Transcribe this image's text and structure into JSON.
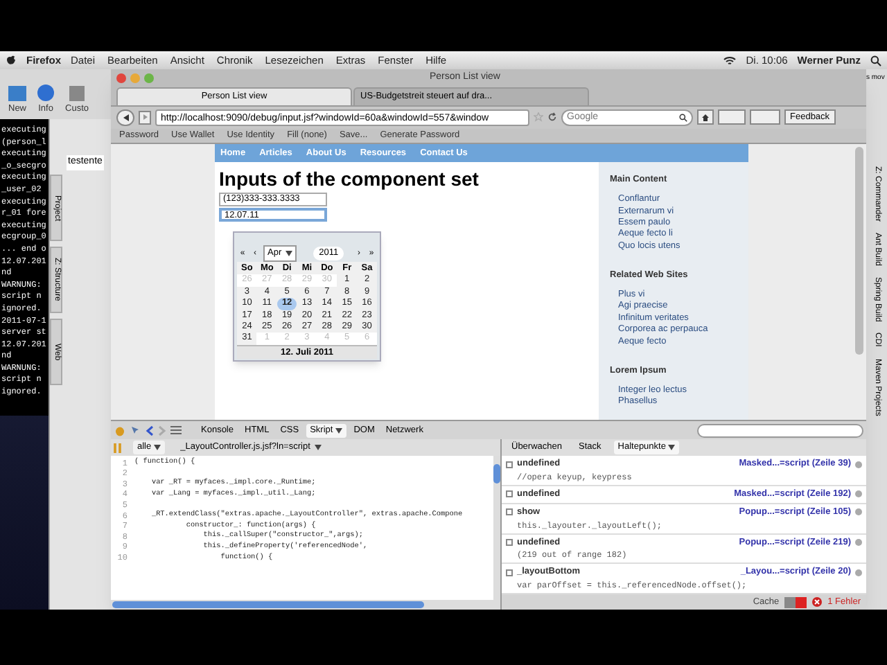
{
  "menu_bar": {
    "app": "Firefox",
    "items": [
      "Datei",
      "Bearbeiten",
      "Ansicht",
      "Chronik",
      "Lesezeichen",
      "Extras",
      "Fenster",
      "Hilfe"
    ],
    "clock": "Di. 10:06",
    "user": "Werner Punz"
  },
  "toolbar_window": {
    "buttons": [
      "New",
      "Info",
      "Custo"
    ]
  },
  "terminal": {
    "lines": [
      "executing",
      "(person_l",
      "executing",
      "_o_secgro",
      "executing",
      "_user_02",
      "executing",
      "r_01 fore",
      "executing",
      "ecgroup_0",
      "... end o",
      "12.07.201",
      "nd",
      "WARNUNG: ",
      "script n",
      "ignored.",
      "2011-07-1",
      "server st",
      "12.07.201",
      "nd",
      "WARNUNG: ",
      "script n",
      "ignored."
    ]
  },
  "ide": {
    "tab": "testente",
    "side_tabs": [
      "Project",
      "Z: Structure",
      "Web"
    ]
  },
  "firefox": {
    "title": "Person List view",
    "tabs": [
      {
        "label": "Person List view",
        "selected": true
      },
      {
        "label": "US-Budgetstreit steuert auf dra...",
        "selected": false
      }
    ],
    "url": "http://localhost:9090/debug/input.jsf?windowId=60a&windowId=557&window",
    "search_placeholder": "Google",
    "feedback": "Feedback",
    "bookmarks": [
      "Password",
      "Use Wallet",
      "Use Identity",
      "Fill (none)",
      "Save...",
      "Generate Password"
    ]
  },
  "page": {
    "nav": [
      "Home",
      "Articles",
      "About Us",
      "Resources",
      "Contact Us"
    ],
    "heading": "Inputs of the component set",
    "fields": [
      {
        "value": "(123)333-333.3333",
        "focused": false
      },
      {
        "value": "12.07.11",
        "focused": true
      }
    ],
    "calendar": {
      "nav_buttons": [
        "«",
        "‹",
        "›",
        "»"
      ],
      "month": "Apr",
      "year": "2011",
      "weekdays": [
        "So",
        "Mo",
        "Di",
        "Mi",
        "Do",
        "Fr",
        "Sa"
      ],
      "footer": "12. Juli 2011",
      "days": [
        {
          "day": "26",
          "current": false,
          "selected": false
        },
        {
          "day": "27",
          "current": false,
          "selected": false
        },
        {
          "day": "28",
          "current": false,
          "selected": false
        },
        {
          "day": "29",
          "current": false,
          "selected": false
        },
        {
          "day": "30",
          "current": false,
          "selected": false
        },
        {
          "day": "1",
          "current": true,
          "selected": false
        },
        {
          "day": "2",
          "current": true,
          "selected": false
        },
        {
          "day": "3",
          "current": true,
          "selected": false
        },
        {
          "day": "4",
          "current": true,
          "selected": false
        },
        {
          "day": "5",
          "current": true,
          "selected": false
        },
        {
          "day": "6",
          "current": true,
          "selected": false
        },
        {
          "day": "7",
          "current": true,
          "selected": false
        },
        {
          "day": "8",
          "current": true,
          "selected": false
        },
        {
          "day": "9",
          "current": true,
          "selected": false
        },
        {
          "day": "10",
          "current": true,
          "selected": false
        },
        {
          "day": "11",
          "current": true,
          "selected": false
        },
        {
          "day": "12",
          "current": true,
          "selected": true
        },
        {
          "day": "13",
          "current": true,
          "selected": false
        },
        {
          "day": "14",
          "current": true,
          "selected": false
        },
        {
          "day": "15",
          "current": true,
          "selected": false
        },
        {
          "day": "16",
          "current": true,
          "selected": false
        },
        {
          "day": "17",
          "current": true,
          "selected": false
        },
        {
          "day": "18",
          "current": true,
          "selected": false
        },
        {
          "day": "19",
          "current": true,
          "selected": false
        },
        {
          "day": "20",
          "current": true,
          "selected": false
        },
        {
          "day": "21",
          "current": true,
          "selected": false
        },
        {
          "day": "22",
          "current": true,
          "selected": false
        },
        {
          "day": "23",
          "current": true,
          "selected": false
        },
        {
          "day": "24",
          "current": true,
          "selected": false
        },
        {
          "day": "25",
          "current": true,
          "selected": false
        },
        {
          "day": "26",
          "current": true,
          "selected": false
        },
        {
          "day": "27",
          "current": true,
          "selected": false
        },
        {
          "day": "28",
          "current": true,
          "selected": false
        },
        {
          "day": "29",
          "current": true,
          "selected": false
        },
        {
          "day": "30",
          "current": true,
          "selected": false
        },
        {
          "day": "31",
          "current": true,
          "selected": false
        },
        {
          "day": "1",
          "current": false,
          "selected": false
        },
        {
          "day": "2",
          "current": false,
          "selected": false
        },
        {
          "day": "3",
          "current": false,
          "selected": false
        },
        {
          "day": "4",
          "current": false,
          "selected": false
        },
        {
          "day": "5",
          "current": false,
          "selected": false
        },
        {
          "day": "6",
          "current": false,
          "selected": false
        }
      ]
    },
    "sidebar": [
      {
        "title": "Main Content",
        "items": [
          "Conflantur",
          "Externarum vi",
          "Essem paulo",
          "Aeque fecto li",
          "Quo locis utens"
        ]
      },
      {
        "title": "Related Web Sites",
        "items": [
          "Plus vi",
          "Agi praecise",
          "Infinitum veritates",
          "Corporea ac perpauca",
          "Aeque fecto"
        ]
      },
      {
        "title": "Lorem Ipsum",
        "items": [
          "Integer leo lectus",
          "Phasellus"
        ]
      }
    ]
  },
  "firebug": {
    "tabs": [
      {
        "label": "Konsole",
        "selected": false
      },
      {
        "label": "HTML",
        "selected": false
      },
      {
        "label": "CSS",
        "selected": false
      },
      {
        "label": "Skript",
        "selected": true
      },
      {
        "label": "DOM",
        "selected": false
      },
      {
        "label": "Netzwerk",
        "selected": false
      }
    ],
    "filter": "alle",
    "file": "_LayoutController.js.jsf?ln=script",
    "code": [
      {
        "number": "1",
        "text": "( function() {"
      },
      {
        "number": "2"
      },
      {
        "number": "3",
        "text": "    var _RT = myfaces._impl.core._Runtime;"
      },
      {
        "number": "4",
        "text": "    var _Lang = myfaces._impl._util._Lang;"
      },
      {
        "number": "5"
      },
      {
        "number": "6",
        "text": "    _RT.extendClass(\"extras.apache._LayoutController\", extras.apache.Compone"
      },
      {
        "number": "7",
        "text": "            constructor_: function(args) {"
      },
      {
        "number": "8",
        "text": "                this._callSuper(\"constructor_\",args);"
      },
      {
        "number": "9",
        "text": "                this._defineProperty('referencedNode',"
      },
      {
        "number": "10",
        "text": "                    function() {"
      }
    ],
    "side_tabs": [
      {
        "label": "Überwachen",
        "selected": false
      },
      {
        "label": "Stack",
        "selected": false
      },
      {
        "label": "Haltepunkte",
        "selected": true
      }
    ],
    "breakpoints": [
      {
        "checked": false,
        "name": "undefined",
        "location": "Masked...=script (Zeile 39)",
        "code": "//opera keyup, keypress"
      },
      {
        "checked": false,
        "name": "undefined",
        "location": "Masked...=script (Zeile 192)"
      },
      {
        "checked": false,
        "name": "show",
        "location": "Popup...=script (Zeile 105)",
        "code": "this._layouter._layoutLeft();"
      },
      {
        "checked": false,
        "name": "undefined",
        "location": "Popup...=script (Zeile 219)",
        "code": "(219 out of range 182)"
      },
      {
        "checked": false,
        "name": "_layoutBottom",
        "location": "_Layou...=script (Zeile 20)",
        "code": "var parOffset = this._referencedNode.offset();"
      }
    ],
    "status": {
      "cache": "Cache",
      "cache_on": true,
      "errors": "1 Fehler"
    }
  },
  "right_edge": {
    "snippet": "s mov",
    "labels": [
      "Z: Commander",
      "Ant Build",
      "Spring Build",
      "CDI",
      "Maven Projects"
    ]
  }
}
